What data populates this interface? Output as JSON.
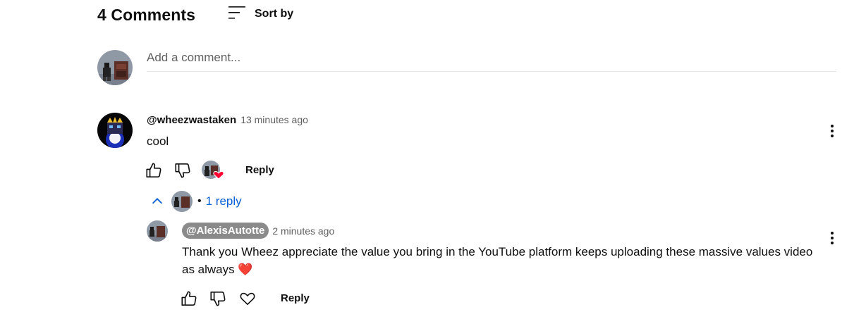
{
  "header": {
    "title": "4 Comments",
    "sort_label": "Sort by"
  },
  "add_comment": {
    "placeholder": "Add a comment..."
  },
  "comments": [
    {
      "author": "@wheezwastaken",
      "time": "13 minutes ago",
      "text": "cool",
      "reply_label": "Reply",
      "replies_label": "1 reply",
      "replies": [
        {
          "author": "@AlexisAutotte",
          "time": "2 minutes ago",
          "text": "Thank you Wheez appreciate the value you bring in the YouTube platform keeps uploading these massive values video as always ❤️",
          "reply_label": "Reply"
        }
      ]
    }
  ],
  "colors": {
    "link": "#065fd4",
    "secondary_text": "#606060",
    "heart": "#ff0033",
    "author_chip": "#8a8a8a"
  },
  "icons": [
    "sort-icon",
    "thumbs-up-icon",
    "thumbs-down-icon",
    "heart-icon",
    "chevron-up-icon",
    "more-vert-icon"
  ]
}
